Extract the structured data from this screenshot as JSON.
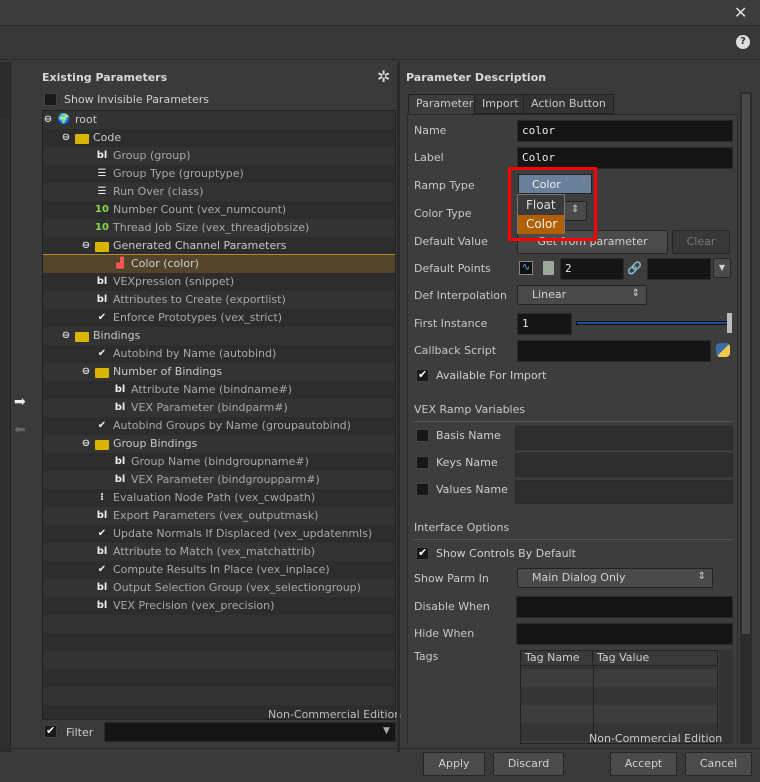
{
  "window": {
    "close_icon": "close-icon",
    "help_icon": "help-icon"
  },
  "existing": {
    "title": "Existing Parameters",
    "show_invisible": "Show Invisible Parameters",
    "show_invisible_checked": false,
    "rows": [
      {
        "label": "root",
        "icon": "globe",
        "level": 0
      },
      {
        "label": "Code",
        "icon": "folder",
        "level": 1
      },
      {
        "label": "Group (group)",
        "icon": "string",
        "level": 2
      },
      {
        "label": "Group Type (grouptype)",
        "icon": "menu",
        "level": 2
      },
      {
        "label": "Run Over (class)",
        "icon": "menu",
        "level": 2
      },
      {
        "label": "Number Count (vex_numcount)",
        "icon": "integer",
        "level": 2
      },
      {
        "label": "Thread Job Size (vex_threadjobsize)",
        "icon": "integer",
        "level": 2
      },
      {
        "label": "Generated Channel Parameters",
        "icon": "folder",
        "level": 2
      },
      {
        "label": "Color (color)",
        "icon": "ramp",
        "level": 3,
        "selected": true
      },
      {
        "label": "VEXpression (snippet)",
        "icon": "string",
        "level": 2
      },
      {
        "label": "Attributes to Create (exportlist)",
        "icon": "string",
        "level": 2
      },
      {
        "label": "Enforce Prototypes (vex_strict)",
        "icon": "toggle",
        "level": 2
      },
      {
        "label": "Bindings",
        "icon": "folder",
        "level": 1
      },
      {
        "label": "Autobind by Name (autobind)",
        "icon": "toggle",
        "level": 2
      },
      {
        "label": "Number of Bindings",
        "icon": "folder",
        "level": 2
      },
      {
        "label": "Attribute Name (bindname#)",
        "icon": "string",
        "level": 3
      },
      {
        "label": "VEX Parameter (bindparm#)",
        "icon": "string",
        "level": 3
      },
      {
        "label": "Autobind Groups by Name (groupautobind)",
        "icon": "toggle",
        "level": 2
      },
      {
        "label": "Group Bindings",
        "icon": "folder",
        "level": 2
      },
      {
        "label": "Group Name (bindgroupname#)",
        "icon": "string",
        "level": 3
      },
      {
        "label": "VEX Parameter (bindgroupparm#)",
        "icon": "string",
        "level": 3
      },
      {
        "label": "Evaluation Node Path (vex_cwdpath)",
        "icon": "oppath",
        "level": 2
      },
      {
        "label": "Export Parameters (vex_outputmask)",
        "icon": "string",
        "level": 2
      },
      {
        "label": "Update Normals If Displaced (vex_updatenmls)",
        "icon": "toggle",
        "level": 2
      },
      {
        "label": "Attribute to Match (vex_matchattrib)",
        "icon": "string",
        "level": 2
      },
      {
        "label": "Compute Results In Place (vex_inplace)",
        "icon": "toggle",
        "level": 2
      },
      {
        "label": "Output Selection Group (vex_selectiongroup)",
        "icon": "string",
        "level": 2
      },
      {
        "label": "VEX Precision (vex_precision)",
        "icon": "string",
        "level": 2
      }
    ],
    "watermark": "Non-Commercial Edition",
    "filter_label": "Filter",
    "filter_value": ""
  },
  "desc": {
    "title": "Parameter Description",
    "tabs": [
      "Parameter",
      "Import",
      "Action Button"
    ],
    "active_tab": "Parameter",
    "name_label": "Name",
    "name_value": "color",
    "label_label": "Label",
    "label_value": "Color",
    "ramp_type_label": "Ramp Type",
    "ramp_type_value": "Color",
    "ramp_options": [
      "Float",
      "Color"
    ],
    "ramp_highlight": "Color",
    "color_type_label": "Color Type",
    "default_value_label": "Default Value",
    "get_from_parameter": "Get from parameter",
    "clear": "Clear",
    "default_points_label": "Default Points",
    "default_points_value": "2",
    "def_interp_label": "Def Interpolation",
    "def_interp_value": "Linear",
    "first_instance_label": "First Instance",
    "first_instance_value": "1",
    "callback_label": "Callback Script",
    "callback_value": "",
    "available_import": "Available For Import",
    "available_import_checked": true,
    "vex_ramp_vars": "VEX Ramp Variables",
    "basis_name": "Basis Name",
    "keys_name": "Keys Name",
    "values_name": "Values Name",
    "interface_options": "Interface Options",
    "show_controls": "Show Controls By Default",
    "show_controls_checked": true,
    "show_parm_in_label": "Show Parm In",
    "show_parm_in_value": "Main Dialog Only",
    "disable_when_label": "Disable When",
    "hide_when_label": "Hide When",
    "tags_label": "Tags",
    "tag_columns": [
      "Tag Name",
      "Tag Value"
    ],
    "watermark": "Non-Commercial Edition"
  },
  "buttons": {
    "apply": "Apply",
    "discard": "Discard",
    "accept": "Accept",
    "cancel": "Cancel"
  },
  "colors": {
    "highlight_box": "#ff0000",
    "selected_option": "#b06000",
    "selected_row": "#53452c"
  }
}
